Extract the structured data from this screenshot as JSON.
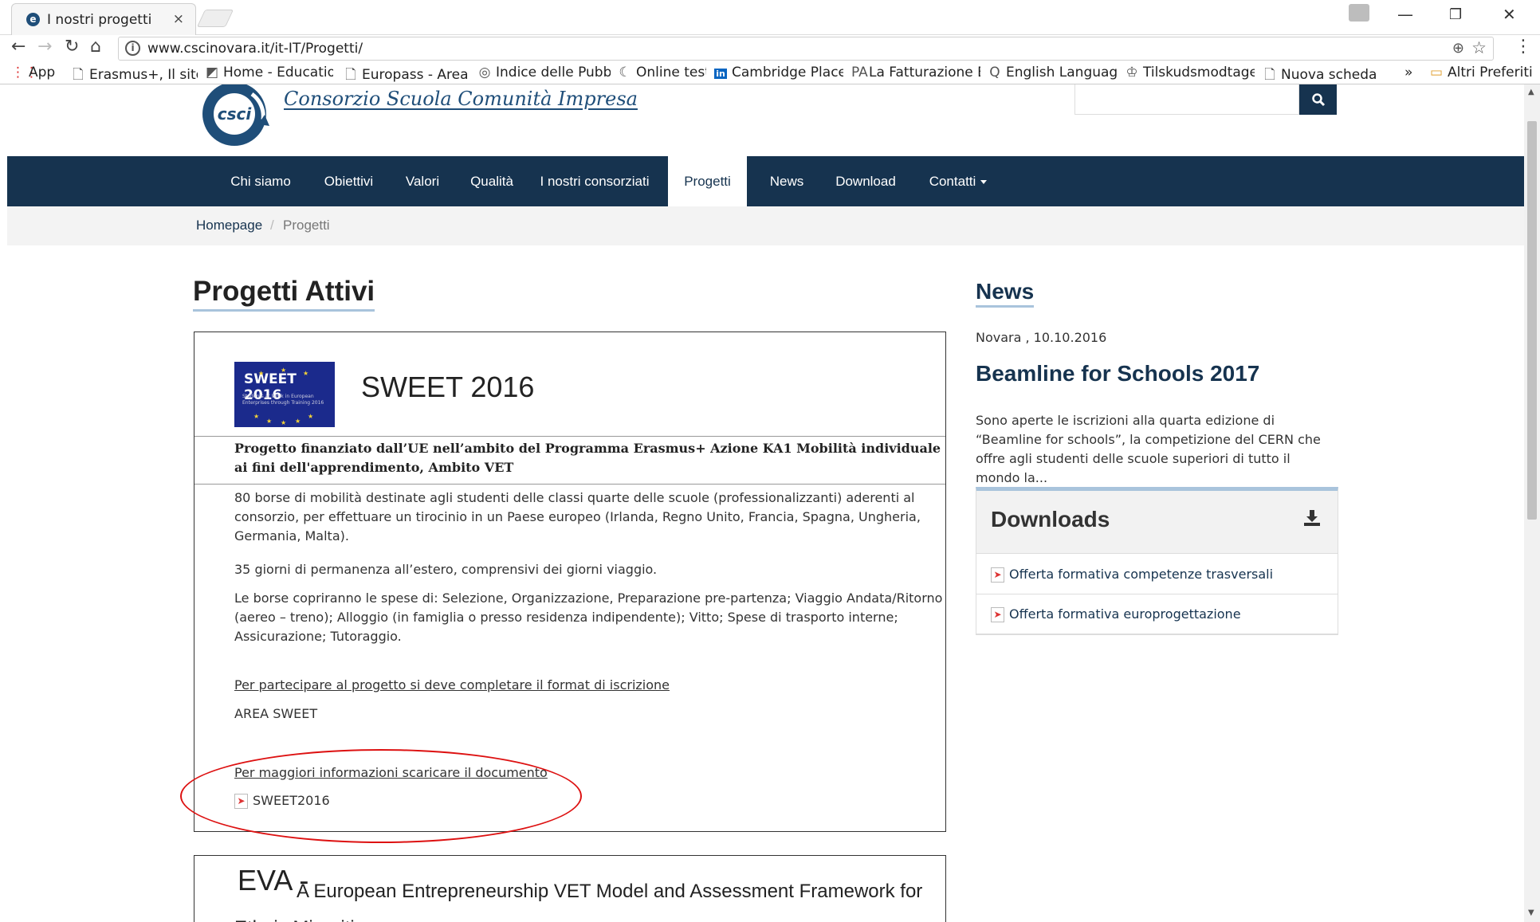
{
  "browser": {
    "tab_title": "I nostri progetti",
    "tab_close": "×",
    "url": "www.cscinovara.it/it-IT/Progetti/",
    "bookmarks": [
      {
        "icon": "apps-icon",
        "glyph": "⋮⋮",
        "label": "App"
      },
      {
        "icon": "page-icon",
        "glyph": "🗋",
        "label": "Erasmus+, Il sito"
      },
      {
        "icon": "home-education-icon",
        "glyph": "◩",
        "label": "Home - Educatio"
      },
      {
        "icon": "page-icon",
        "glyph": "🗋",
        "label": "Europass - Area R"
      },
      {
        "icon": "globe-icon",
        "glyph": "◎",
        "label": "Indice delle Pubb"
      },
      {
        "icon": "moon-icon",
        "glyph": "☾",
        "label": "Online test"
      },
      {
        "icon": "linkedin-icon",
        "glyph": "in",
        "label": "Cambridge Place"
      },
      {
        "icon": "pa-icon",
        "glyph": "PA",
        "label": "La Fatturazione El"
      },
      {
        "icon": "q-icon",
        "glyph": "Q",
        "label": "English Language"
      },
      {
        "icon": "crown-icon",
        "glyph": "♔",
        "label": "Tilskudsmodtage"
      },
      {
        "icon": "page-icon",
        "glyph": "🗋",
        "label": "Nuova scheda"
      }
    ],
    "bookmarks_more": "»",
    "other_bookmarks": "Altri Preferiti"
  },
  "header": {
    "logo_text": "csci",
    "brand_name": "Consorzio Scuola Comunità Impresa"
  },
  "nav": {
    "items": [
      "Chi siamo",
      "Obiettivi",
      "Valori",
      "Qualità",
      "I nostri consorziati",
      "Progetti",
      "News",
      "Download",
      "Contatti"
    ],
    "active": "Progetti"
  },
  "breadcrumb": {
    "home": "Homepage",
    "separator": "/",
    "current": "Progetti"
  },
  "main": {
    "title": "Progetti Attivi",
    "project": {
      "logo_title": "SWEET 2016",
      "logo_sub": "Students at Work in European Enterprises through Training 2016",
      "name": "SWEET 2016",
      "subtitle": "Progetto finanziato dall’UE nell’ambito del Programma Erasmus+  Azione KA1 Mobilità individuale ai fini dell'apprendimento, Ambito VET",
      "p1": "80 borse di mobilità destinate agli studenti delle classi quarte delle scuole (professionalizzanti) aderenti al consorzio, per effettuare un tirocinio in un Paese europeo (Irlanda, Regno Unito, Francia, Spagna, Ungheria, Germania, Malta).",
      "p2": "35 giorni di permanenza all’estero, comprensivi dei giorni viaggio.",
      "p3": "Le borse copriranno le spese di: Selezione, Organizzazione, Preparazione pre-partenza; Viaggio Andata/Ritorno (aereo – treno); Alloggio (in famiglia o presso residenza indipendente); Vitto; Spese di trasporto interne; Assicurazione; Tutoraggio.",
      "link_signup": "Per partecipare al progetto si deve completare il format di iscrizione ",
      "area": "AREA SWEET",
      "link_info": "Per maggiori informazioni scaricare il documento",
      "file": "SWEET2016"
    },
    "project2": {
      "acronym": "EVA -",
      "name": "A European Entrepreneurship VET Model and Assessment Framework for Ethnic Minorities"
    }
  },
  "sidebar": {
    "news_heading": "News",
    "news_date": "Novara , 10.10.2016",
    "news_title": "Beamline for Schools 2017",
    "news_excerpt": "Sono aperte le iscrizioni alla quarta edizione di “Beamline for schools”,  la competizione del CERN che offre agli studenti delle scuole superiori di tutto il mondo la...",
    "downloads_title": "Downloads",
    "downloads": [
      "Offerta formativa competenze trasversali",
      "Offerta formativa europrogettazione"
    ]
  },
  "colors": {
    "nav_bg": "#16334f",
    "accent_underline": "#a9c4dc",
    "annotation": "#d11111"
  }
}
